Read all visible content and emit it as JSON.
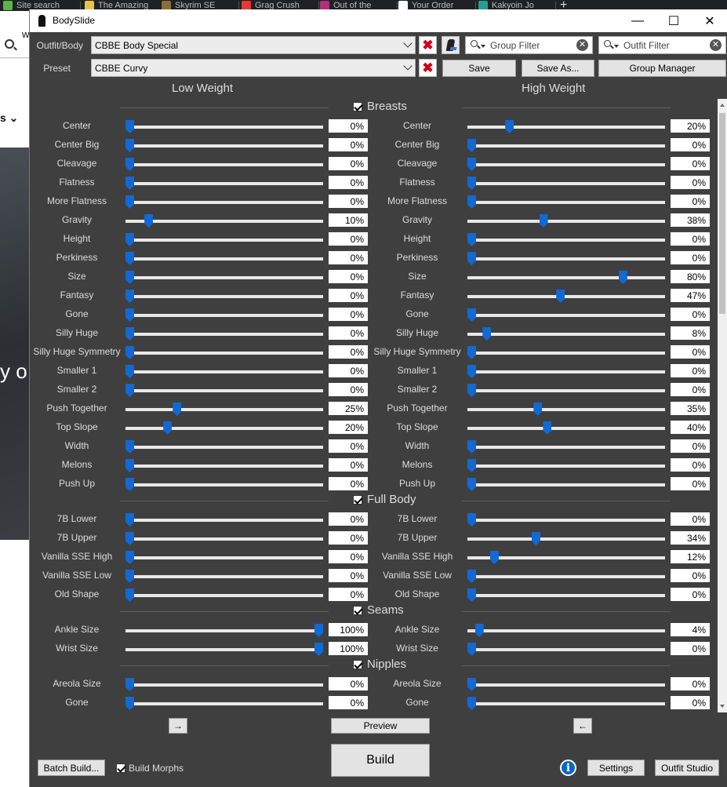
{
  "browser": {
    "tabs": [
      {
        "label": "Site search",
        "color": "#5fb34b"
      },
      {
        "label": "The Amazing",
        "color": "#e7c34b"
      },
      {
        "label": "Skyrim SE",
        "color": "#8a6d3b"
      },
      {
        "label": "Grag Crush",
        "color": "#e53935"
      },
      {
        "label": "Out of the",
        "color": "#b0307a"
      },
      {
        "label": "Your Order",
        "color": "#ffffff"
      },
      {
        "label": "Kakyoin Jo",
        "color": "#2a9d8f"
      }
    ],
    "new_tab": "+",
    "search_fragment": "w",
    "nav_fragment": "s ⌄",
    "hero_fragment": "y o"
  },
  "window": {
    "title": "BodySlide",
    "min": "—",
    "max": "☐",
    "close": "✕"
  },
  "top": {
    "outfit_label": "Outfit/Body",
    "outfit_value": "CBBE Body Special",
    "preset_label": "Preset",
    "preset_value": "CBBE Curvy",
    "x_glyph": "✖",
    "group_filter": "Group Filter",
    "outfit_filter": "Outfit Filter",
    "clear_glyph": "✕",
    "save": "Save",
    "save_as": "Save As...",
    "group_manager": "Group Manager"
  },
  "headers": {
    "low": "Low Weight",
    "high": "High Weight"
  },
  "sections": [
    {
      "name": "Breasts",
      "checked": true,
      "sliders": [
        {
          "label": "Center",
          "low": 0,
          "high": 20
        },
        {
          "label": "Center Big",
          "low": 0,
          "high": 0
        },
        {
          "label": "Cleavage",
          "low": 0,
          "high": 0
        },
        {
          "label": "Flatness",
          "low": 0,
          "high": 0
        },
        {
          "label": "More Flatness",
          "low": 0,
          "high": 0
        },
        {
          "label": "Gravity",
          "low": 10,
          "high": 38
        },
        {
          "label": "Height",
          "low": 0,
          "high": 0
        },
        {
          "label": "Perkiness",
          "low": 0,
          "high": 0
        },
        {
          "label": "Size",
          "low": 0,
          "high": 80
        },
        {
          "label": "Fantasy",
          "low": 0,
          "high": 47
        },
        {
          "label": "Gone",
          "low": 0,
          "high": 0
        },
        {
          "label": "Silly Huge",
          "low": 0,
          "high": 8
        },
        {
          "label": "Silly Huge Symmetry",
          "low": 0,
          "high": 0
        },
        {
          "label": "Smaller 1",
          "low": 0,
          "high": 0
        },
        {
          "label": "Smaller 2",
          "low": 0,
          "high": 0
        },
        {
          "label": "Push Together",
          "low": 25,
          "high": 35
        },
        {
          "label": "Top Slope",
          "low": 20,
          "high": 40
        },
        {
          "label": "Width",
          "low": 0,
          "high": 0
        },
        {
          "label": "Melons",
          "low": 0,
          "high": 0
        },
        {
          "label": "Push Up",
          "low": 0,
          "high": 0
        }
      ]
    },
    {
      "name": "Full Body",
      "checked": true,
      "sliders": [
        {
          "label": "7B Lower",
          "low": 0,
          "high": 0
        },
        {
          "label": "7B Upper",
          "low": 0,
          "high": 34
        },
        {
          "label": "Vanilla SSE High",
          "low": 0,
          "high": 12
        },
        {
          "label": "Vanilla SSE Low",
          "low": 0,
          "high": 0
        },
        {
          "label": "Old Shape",
          "low": 0,
          "high": 0
        }
      ]
    },
    {
      "name": "Seams",
      "checked": true,
      "sliders": [
        {
          "label": "Ankle Size",
          "low": 100,
          "high": 4
        },
        {
          "label": "Wrist Size",
          "low": 100,
          "high": 0
        }
      ]
    },
    {
      "name": "Nipples",
      "checked": true,
      "sliders": [
        {
          "label": "Areola Size",
          "low": 0,
          "high": 0
        },
        {
          "label": "Gone",
          "low": 0,
          "high": 0
        }
      ]
    }
  ],
  "bottom": {
    "copy_right": "→",
    "copy_left": "←",
    "preview": "Preview",
    "build": "Build",
    "batch_build": "Batch Build...",
    "build_morphs": "Build Morphs",
    "build_morphs_checked": true,
    "info": "i",
    "settings": "Settings",
    "outfit_studio": "Outfit Studio"
  },
  "colors": {
    "thumb": "#1269d3",
    "background": "#3f3f3f",
    "x_red": "#d0001a"
  }
}
